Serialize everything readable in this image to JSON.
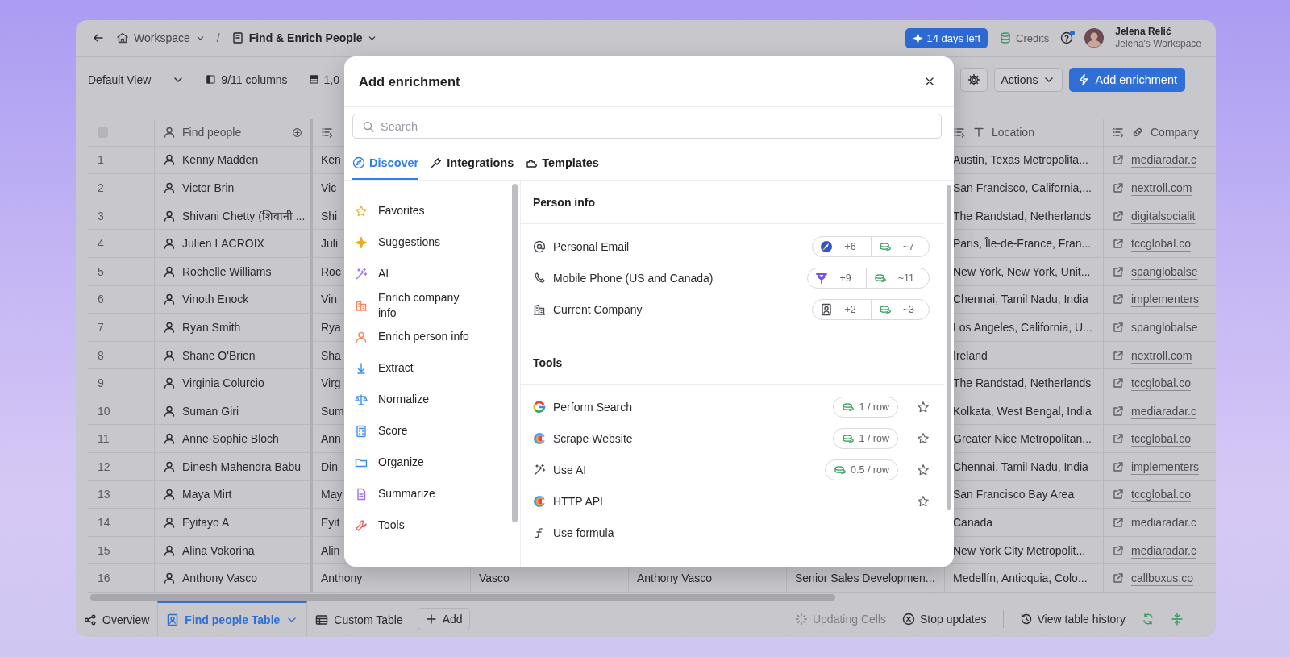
{
  "topbar": {
    "breadcrumbs": [
      {
        "label": "Workspace"
      },
      {
        "label": "Find & Enrich People"
      }
    ],
    "separator": "/",
    "trial": "14 days left",
    "credits": "Credits",
    "user": {
      "name": "Jelena Relić",
      "workspace": "Jelena's Workspace"
    }
  },
  "toolbar": {
    "view": "Default View",
    "columns": "9/11 columns",
    "rows": "1,0",
    "actions": "Actions",
    "add_enrichment": "Add enrichment"
  },
  "table": {
    "columns": [
      {
        "kind": "select",
        "checked": false
      },
      {
        "kind": "person",
        "label": "Find people"
      },
      {
        "kind": "text",
        "sortable": true
      },
      {
        "kind": "text"
      },
      {
        "kind": "text"
      },
      {
        "kind": "text"
      },
      {
        "kind": "text",
        "sortable": true,
        "label": "Location"
      },
      {
        "kind": "link",
        "sortable": true,
        "label": "Company"
      }
    ],
    "rows": [
      {
        "number": "1",
        "name": "Kenny Madden",
        "column_3": "Ken",
        "location": "Austin, Texas Metropolita...",
        "company": "mediaradar.c"
      },
      {
        "number": "2",
        "name": "Victor Brin",
        "column_3": "Vic",
        "location": "San Francisco, California,...",
        "company": "nextroll.com"
      },
      {
        "number": "3",
        "name": "Shivani Chetty (शिवानी ...",
        "column_3": "Shi",
        "location": "The Randstad, Netherlands",
        "company": "digitalsocialit"
      },
      {
        "number": "4",
        "name": "Julien LACROIX",
        "column_3": "Juli",
        "location": "Paris, Île-de-France, Fran...",
        "company": "tccglobal.co"
      },
      {
        "number": "5",
        "name": "Rochelle Williams",
        "column_3": "Roc",
        "location": "New York, New York, Unit...",
        "company": "spanglobalse"
      },
      {
        "number": "6",
        "name": "Vinoth Enock",
        "column_3": "Vin",
        "location": "Chennai, Tamil Nadu, India",
        "company": "implementers"
      },
      {
        "number": "7",
        "name": "Ryan Smith",
        "column_3": "Rya",
        "location": "Los Angeles, California, U...",
        "company": "spanglobalse"
      },
      {
        "number": "8",
        "name": "Shane O'Brien",
        "column_3": "Sha",
        "location": "Ireland",
        "company": "nextroll.com"
      },
      {
        "number": "9",
        "name": "Virginia Colurcio",
        "column_3": "Virg",
        "location": "The Randstad, Netherlands",
        "company": "tccglobal.co"
      },
      {
        "number": "10",
        "name": "Suman Giri",
        "column_3": "Sum",
        "location": "Kolkata, West Bengal, India",
        "company": "mediaradar.c"
      },
      {
        "number": "11",
        "name": "Anne-Sophie Bloch",
        "column_3": "Ann",
        "location": "Greater Nice Metropolitan...",
        "company": "tccglobal.co"
      },
      {
        "number": "12",
        "name": "Dinesh Mahendra Babu",
        "column_3": "Din",
        "location": "Chennai, Tamil Nadu, India",
        "company": "implementers"
      },
      {
        "number": "13",
        "name": "Maya Mirt",
        "column_3": "May",
        "location": "San Francisco Bay Area",
        "company": "tccglobal.co"
      },
      {
        "number": "14",
        "name": "Eyitayo A",
        "column_3": "Eyit",
        "location": "Canada",
        "company": "mediaradar.c"
      },
      {
        "number": "15",
        "name": "Alina Vokorina",
        "column_3": "Alin",
        "location": "New York City Metropolit...",
        "company": "mediaradar.c"
      },
      {
        "number": "16",
        "name": "Anthony Vasco",
        "column_3": "Anthony",
        "column_4": "Vasco",
        "column_5": "Anthony Vasco",
        "column_6": "Senior Sales Developmen...",
        "location": "Medellín, Antioquia, Colo...",
        "company": "callboxus.co"
      }
    ]
  },
  "bottom_bar": {
    "tabs": [
      {
        "label": "Overview",
        "selected": false
      },
      {
        "label": "Find people Table",
        "selected": true
      },
      {
        "label": "Custom Table",
        "selected": false
      }
    ],
    "add": "Add",
    "status": "Updating Cells",
    "stop": "Stop updates",
    "history": "View table history"
  },
  "modal": {
    "title": "Add enrichment",
    "search": {
      "placeholder": "Search"
    },
    "tabs": [
      {
        "label": "Discover",
        "selected": true
      },
      {
        "label": "Integrations",
        "selected": false
      },
      {
        "label": "Templates",
        "selected": false
      }
    ],
    "categories": [
      {
        "label": "Favorites"
      },
      {
        "label": "Suggestions"
      },
      {
        "label": "AI"
      },
      {
        "label": "Enrich company info"
      },
      {
        "label": "Enrich person info"
      },
      {
        "label": "Extract"
      },
      {
        "label": "Normalize"
      },
      {
        "label": "Score"
      },
      {
        "label": "Organize"
      },
      {
        "label": "Summarize"
      },
      {
        "label": "Tools"
      }
    ],
    "sections": [
      {
        "title": "Person info",
        "items": [
          {
            "kind": "waterfall",
            "label": "Personal Email",
            "providers": "+6",
            "credits": "~7"
          },
          {
            "kind": "waterfall",
            "label": "Mobile Phone (US and Canada)",
            "providers": "+9",
            "credits": "~11"
          },
          {
            "kind": "waterfall",
            "label": "Current Company",
            "providers": "+2",
            "credits": "~3"
          }
        ]
      },
      {
        "title": "Tools",
        "items": [
          {
            "kind": "tool",
            "label": "Perform Search",
            "price": "1 / row",
            "favorite": false
          },
          {
            "kind": "tool",
            "label": "Scrape Website",
            "price": "1 / row",
            "favorite": false
          },
          {
            "kind": "tool",
            "label": "Use AI",
            "price": "0.5 / row",
            "favorite": false
          },
          {
            "kind": "tool",
            "label": "HTTP API",
            "favorite": false
          },
          {
            "kind": "tool",
            "label": "Use formula"
          }
        ]
      }
    ]
  }
}
